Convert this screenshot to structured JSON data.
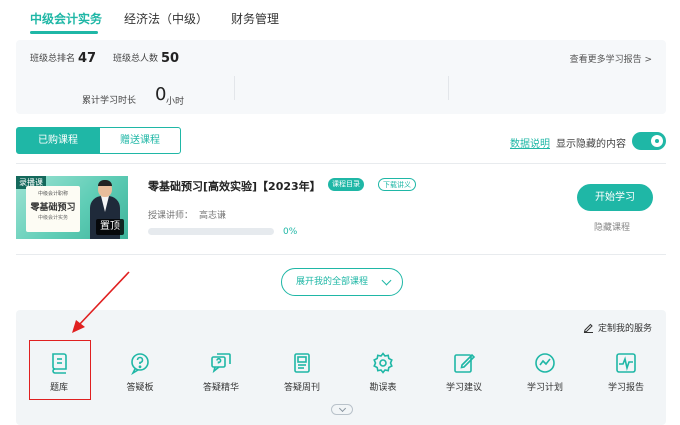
{
  "top_tabs": [
    {
      "label": "中级会计实务",
      "active": true
    },
    {
      "label": "经济法（中级）",
      "active": false
    },
    {
      "label": "财务管理",
      "active": false
    }
  ],
  "stats": {
    "rank_label": "班级总排名",
    "rank_value": "47",
    "total_label": "班级总人数",
    "total_value": "50",
    "report_link": "查看更多学习报告 >",
    "time_label": "累计学习时长",
    "time_value": "0",
    "time_unit": "小时"
  },
  "course_tabs": [
    {
      "label": "已购课程",
      "active": true
    },
    {
      "label": "赠送课程",
      "active": false
    }
  ],
  "data_note_link": "数据说明",
  "show_hidden_label": "显示隐藏的内容",
  "show_hidden_on": true,
  "course": {
    "thumb_tag": "录播课",
    "thumb_line1": "中级会计职称",
    "thumb_line2": "零基础预习",
    "thumb_line3": "中级会计实务",
    "pin_badge": "置顶",
    "title": "零基础预习[高效实验]【2023年】",
    "catalog_pill": "课程目录",
    "download_pill": "下载讲义",
    "teacher_label": "授课讲师：",
    "teacher_name": "高志谦",
    "progress": 0,
    "progress_text": "0%",
    "start_button": "开始学习",
    "hide_button": "隐藏课程"
  },
  "expand_button": "展开我的全部课程",
  "customize_service": "定制我的服务",
  "services": [
    {
      "label": "题库",
      "icon": "question-bank-icon"
    },
    {
      "label": "答疑板",
      "icon": "qa-board-icon"
    },
    {
      "label": "答疑精华",
      "icon": "qa-essence-icon"
    },
    {
      "label": "答疑周刊",
      "icon": "qa-weekly-icon"
    },
    {
      "label": "勘误表",
      "icon": "errata-gear-icon"
    },
    {
      "label": "学习建议",
      "icon": "study-advice-icon"
    },
    {
      "label": "学习计划",
      "icon": "study-plan-icon"
    },
    {
      "label": "学习报告",
      "icon": "study-report-icon"
    }
  ],
  "colors": {
    "accent": "#1fb7a6",
    "annotation": "#e02020"
  }
}
